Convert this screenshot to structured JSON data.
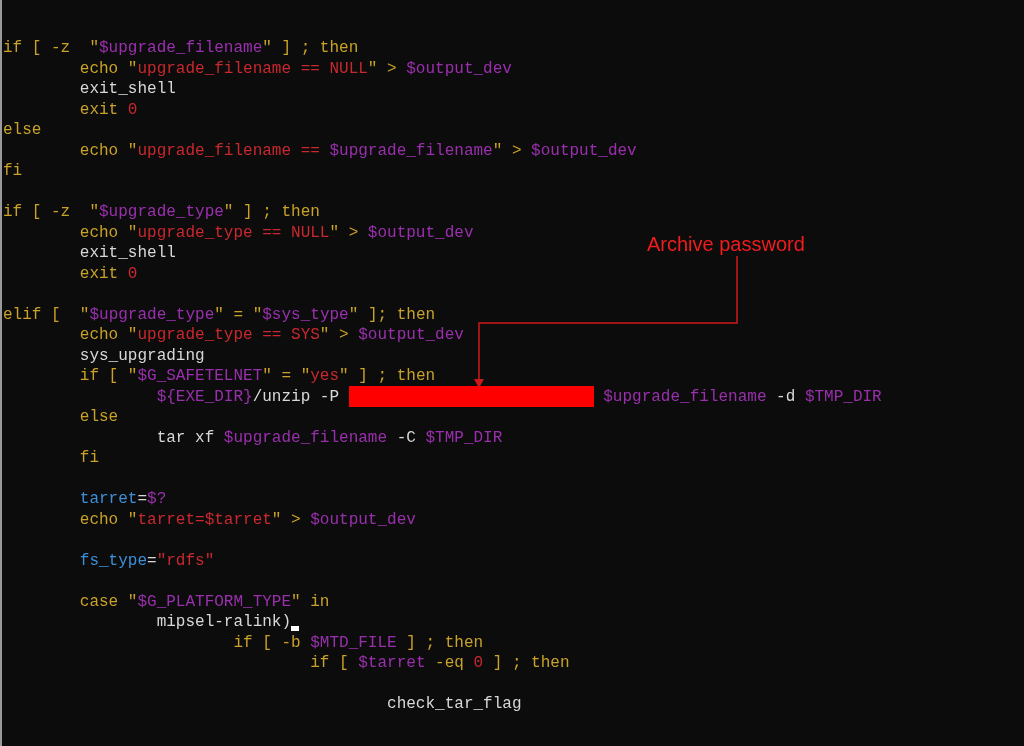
{
  "code_lines": [
    {
      "kind": "code",
      "cursor": false,
      "tokens": [
        {
          "kind": "keyword",
          "text": "if [ -z  \""
        },
        {
          "kind": "variable",
          "text": "$upgrade_filename"
        },
        {
          "kind": "keyword",
          "text": "\" ] ; then"
        }
      ]
    },
    {
      "kind": "code",
      "cursor": false,
      "tokens": [
        {
          "kind": "keyword",
          "text": "        echo \""
        },
        {
          "kind": "string",
          "text": "upgrade_filename == NULL"
        },
        {
          "kind": "keyword",
          "text": "\" > "
        },
        {
          "kind": "variable",
          "text": "$output_dev"
        }
      ]
    },
    {
      "kind": "code",
      "cursor": false,
      "tokens": [
        {
          "kind": "plain",
          "text": "        exit_shell"
        }
      ]
    },
    {
      "kind": "code",
      "cursor": false,
      "tokens": [
        {
          "kind": "keyword",
          "text": "        exit "
        },
        {
          "kind": "number",
          "text": "0"
        }
      ]
    },
    {
      "kind": "code",
      "cursor": false,
      "tokens": [
        {
          "kind": "keyword",
          "text": "else"
        }
      ]
    },
    {
      "kind": "code",
      "cursor": false,
      "tokens": [
        {
          "kind": "keyword",
          "text": "        echo \""
        },
        {
          "kind": "string",
          "text": "upgrade_filename == "
        },
        {
          "kind": "variable",
          "text": "$upgrade_filename"
        },
        {
          "kind": "keyword",
          "text": "\" > "
        },
        {
          "kind": "variable",
          "text": "$output_dev"
        }
      ]
    },
    {
      "kind": "code",
      "cursor": false,
      "tokens": [
        {
          "kind": "keyword",
          "text": "fi"
        }
      ]
    },
    {
      "kind": "blank",
      "cursor": false
    },
    {
      "kind": "code",
      "cursor": false,
      "tokens": [
        {
          "kind": "keyword",
          "text": "if [ -z  \""
        },
        {
          "kind": "variable",
          "text": "$upgrade_type"
        },
        {
          "kind": "keyword",
          "text": "\" ] ; then"
        }
      ]
    },
    {
      "kind": "code",
      "cursor": false,
      "tokens": [
        {
          "kind": "keyword",
          "text": "        echo \""
        },
        {
          "kind": "string",
          "text": "upgrade_type == NULL"
        },
        {
          "kind": "keyword",
          "text": "\" > "
        },
        {
          "kind": "variable",
          "text": "$output_dev"
        }
      ]
    },
    {
      "kind": "code",
      "cursor": false,
      "tokens": [
        {
          "kind": "plain",
          "text": "        exit_shell"
        }
      ]
    },
    {
      "kind": "code",
      "cursor": false,
      "tokens": [
        {
          "kind": "keyword",
          "text": "        exit "
        },
        {
          "kind": "number",
          "text": "0"
        }
      ]
    },
    {
      "kind": "blank",
      "cursor": false
    },
    {
      "kind": "code",
      "cursor": false,
      "tokens": [
        {
          "kind": "keyword",
          "text": "elif [  \""
        },
        {
          "kind": "variable",
          "text": "$upgrade_type"
        },
        {
          "kind": "keyword",
          "text": "\" = \""
        },
        {
          "kind": "variable",
          "text": "$sys_type"
        },
        {
          "kind": "keyword",
          "text": "\" ]; then"
        }
      ]
    },
    {
      "kind": "code",
      "cursor": false,
      "tokens": [
        {
          "kind": "keyword",
          "text": "        echo \""
        },
        {
          "kind": "string",
          "text": "upgrade_type == SYS"
        },
        {
          "kind": "keyword",
          "text": "\" > "
        },
        {
          "kind": "variable",
          "text": "$output_dev"
        }
      ]
    },
    {
      "kind": "code",
      "cursor": false,
      "tokens": [
        {
          "kind": "plain",
          "text": "        sys_upgrading"
        }
      ]
    },
    {
      "kind": "code",
      "cursor": false,
      "tokens": [
        {
          "kind": "keyword",
          "text": "        if [ \""
        },
        {
          "kind": "variable",
          "text": "$G_SAFETELNET"
        },
        {
          "kind": "keyword",
          "text": "\" = \""
        },
        {
          "kind": "string",
          "text": "yes"
        },
        {
          "kind": "keyword",
          "text": "\" ] ; then"
        }
      ]
    },
    {
      "kind": "code",
      "cursor": false,
      "tokens": [
        {
          "kind": "variable",
          "text": "                ${EXE_DIR}"
        },
        {
          "kind": "plain",
          "text": "/unzip -P "
        },
        {
          "kind": "redacted"
        },
        {
          "kind": "variable",
          "text": "$upgrade_filename"
        },
        {
          "kind": "plain",
          "text": " -d "
        },
        {
          "kind": "variable",
          "text": "$TMP_DIR"
        }
      ]
    },
    {
      "kind": "code",
      "cursor": false,
      "tokens": [
        {
          "kind": "keyword",
          "text": "        else"
        }
      ]
    },
    {
      "kind": "code",
      "cursor": false,
      "tokens": [
        {
          "kind": "plain",
          "text": "                tar xf "
        },
        {
          "kind": "variable",
          "text": "$upgrade_filename"
        },
        {
          "kind": "plain",
          "text": " -C "
        },
        {
          "kind": "variable",
          "text": "$TMP_DIR"
        }
      ]
    },
    {
      "kind": "code",
      "cursor": false,
      "tokens": [
        {
          "kind": "keyword",
          "text": "        fi"
        }
      ]
    },
    {
      "kind": "blank",
      "cursor": false
    },
    {
      "kind": "code",
      "cursor": false,
      "tokens": [
        {
          "kind": "assign",
          "text": "        tarret"
        },
        {
          "kind": "plain",
          "text": "="
        },
        {
          "kind": "variable",
          "text": "$?"
        }
      ]
    },
    {
      "kind": "code",
      "cursor": false,
      "tokens": [
        {
          "kind": "keyword",
          "text": "        echo \""
        },
        {
          "kind": "string",
          "text": "tarret=$tarret"
        },
        {
          "kind": "keyword",
          "text": "\" > "
        },
        {
          "kind": "variable",
          "text": "$output_dev"
        }
      ]
    },
    {
      "kind": "blank",
      "cursor": false
    },
    {
      "kind": "code",
      "cursor": false,
      "tokens": [
        {
          "kind": "assign",
          "text": "        fs_type"
        },
        {
          "kind": "plain",
          "text": "="
        },
        {
          "kind": "string",
          "text": "\"rdfs\""
        }
      ]
    },
    {
      "kind": "blank",
      "cursor": false
    },
    {
      "kind": "code",
      "cursor": false,
      "tokens": [
        {
          "kind": "keyword",
          "text": "        case \""
        },
        {
          "kind": "variable",
          "text": "$G_PLATFORM_TYPE"
        },
        {
          "kind": "keyword",
          "text": "\" in"
        }
      ]
    },
    {
      "kind": "code",
      "cursor": true,
      "tokens": [
        {
          "kind": "plain",
          "text": "                mipsel-ralink)"
        }
      ]
    },
    {
      "kind": "code",
      "cursor": false,
      "tokens": [
        {
          "kind": "keyword",
          "text": "                        if [ -b "
        },
        {
          "kind": "variable",
          "text": "$MTD_FILE"
        },
        {
          "kind": "keyword",
          "text": " ] ; then"
        }
      ]
    },
    {
      "kind": "code",
      "cursor": false,
      "tokens": [
        {
          "kind": "keyword",
          "text": "                                if [ "
        },
        {
          "kind": "variable",
          "text": "$tarret"
        },
        {
          "kind": "keyword",
          "text": " -eq "
        },
        {
          "kind": "number",
          "text": "0"
        },
        {
          "kind": "keyword",
          "text": " ] ; then"
        }
      ]
    },
    {
      "kind": "blank",
      "cursor": false
    },
    {
      "kind": "code",
      "cursor": false,
      "tokens": [
        {
          "kind": "plain",
          "text": "                                        check_tar_flag"
        }
      ]
    }
  ],
  "annotation": {
    "label": "Archive password"
  }
}
